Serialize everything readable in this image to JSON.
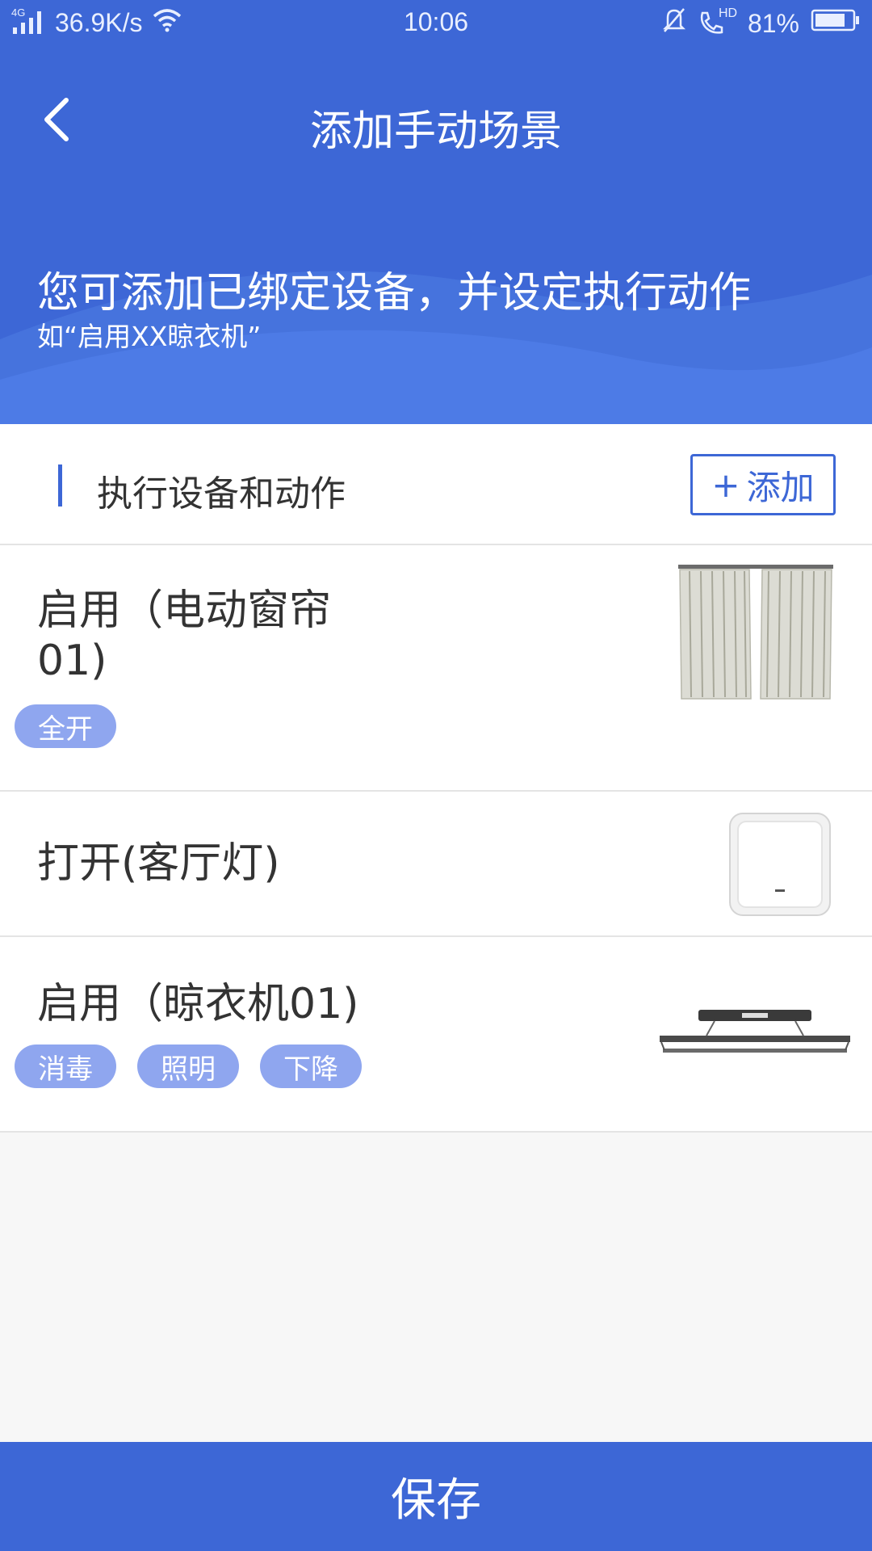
{
  "status_bar": {
    "network_type": "4G",
    "speed": "36.9K/s",
    "time": "10:06",
    "hd": "HD",
    "battery": "81%",
    "battery_level": 0.81
  },
  "header": {
    "title": "添加手动场景",
    "hint_main": "您可添加已绑定设备，并设定执行动作",
    "hint_sub": "如“启用XX晾衣机”"
  },
  "section": {
    "title": "执行设备和动作",
    "add_label": "添加",
    "add_symbol": "+"
  },
  "devices": [
    {
      "name": "启用（电动窗帘01)",
      "tags": [
        "全开"
      ],
      "image_icon": "curtain-image"
    },
    {
      "name": "打开(客厅灯)",
      "tags": [],
      "image_icon": "wall-switch-image"
    },
    {
      "name": "启用（晾衣机01)",
      "tags": [
        "消毒",
        "照明",
        "下降"
      ],
      "image_icon": "clothes-dryer-image"
    }
  ],
  "footer": {
    "save_label": "保存"
  },
  "colors": {
    "primary": "#3d67d6",
    "tag_bg": "#8fa6ef",
    "page_bg": "#f7f7f7"
  }
}
